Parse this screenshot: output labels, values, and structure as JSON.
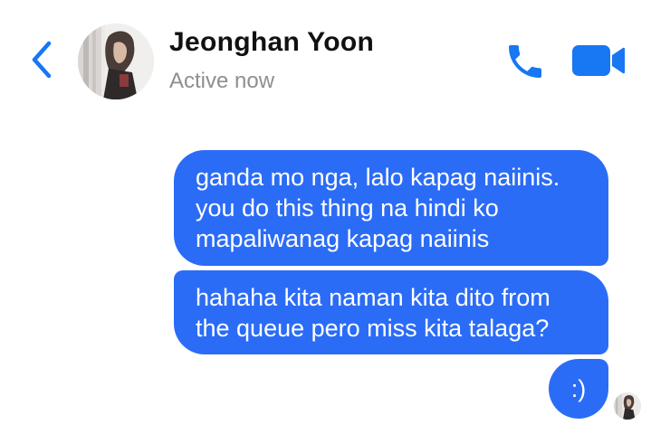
{
  "header": {
    "contact_name": "Jeonghan Yoon",
    "status": "Active now",
    "icons": {
      "back": "chevron-left-icon",
      "call": "phone-icon",
      "video": "video-camera-icon"
    }
  },
  "messages": [
    {
      "sender": "me",
      "text": "ganda mo nga, lalo kapag naiinis.\nyou do this thing na hindi ko\nmapaliwanag kapag naiinis"
    },
    {
      "sender": "me",
      "text": "hahaha kita naman kita dito from\nthe queue pero miss kita talaga?"
    },
    {
      "sender": "me",
      "text": ":)"
    }
  ],
  "colors": {
    "accent": "#1877f2",
    "bubble": "#2b6cf7",
    "status_text": "#8e8e93",
    "name_text": "#111111"
  }
}
